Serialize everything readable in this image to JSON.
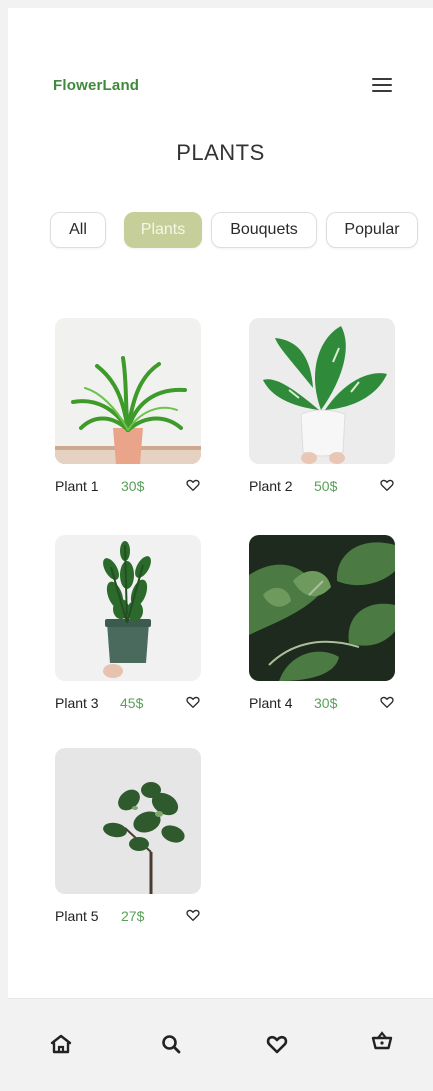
{
  "header": {
    "brand": "FlowerLand",
    "title": "PLANTS"
  },
  "filters": [
    {
      "label": "All",
      "active": false
    },
    {
      "label": "Plants",
      "active": true
    },
    {
      "label": "Bouquets",
      "active": false
    },
    {
      "label": "Popular",
      "active": false
    }
  ],
  "products": [
    {
      "name": "Plant 1",
      "price": "30$"
    },
    {
      "name": "Plant 2",
      "price": "50$"
    },
    {
      "name": "Plant 3",
      "price": "45$"
    },
    {
      "name": "Plant 4",
      "price": "30$"
    },
    {
      "name": "Plant 5",
      "price": "27$"
    }
  ],
  "nav": {
    "icons": [
      "home-icon",
      "search-icon",
      "heart-icon",
      "basket-icon"
    ]
  },
  "colors": {
    "brand": "#3f8a3a",
    "price": "#5aa157",
    "active_chip": "#c6cf99"
  }
}
